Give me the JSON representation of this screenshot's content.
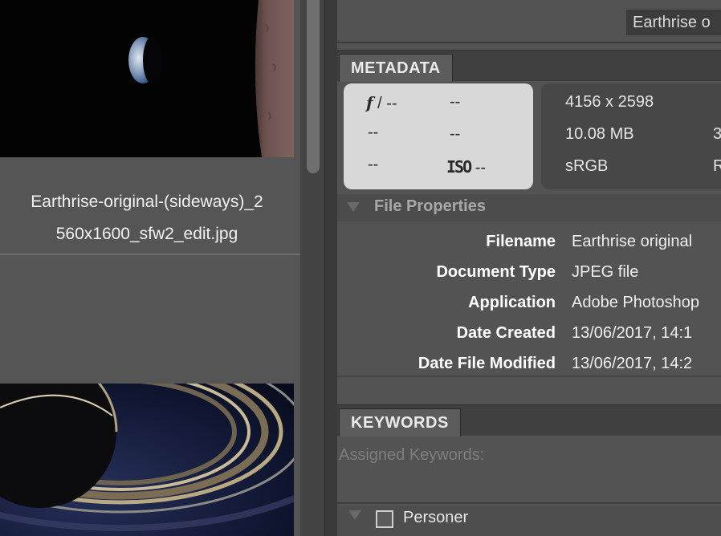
{
  "content": {
    "thumbnail_caption": "Earthrise-original-(sideways)_2 560x1600_sfw2_edit.jpg",
    "caption_line1": "Earthrise-original-(sideways)_2",
    "caption_line2": "560x1600_sfw2_edit.jpg"
  },
  "search": {
    "value": "Earthrise o"
  },
  "metadata_panel": {
    "tab_label": "METADATA",
    "camera": {
      "aperture_symbol": "f",
      "aperture_value": "/ --",
      "shutter": "--",
      "exposure_bias": "--",
      "flash": "--",
      "metering": "--",
      "iso_label": "ISO",
      "iso_value": "--"
    },
    "file_info": {
      "dimensions": "4156 x 2598",
      "file_size": "10.08 MB",
      "color_profile": "sRGB",
      "col2_row2": "3",
      "col2_row3": "R"
    }
  },
  "file_properties": {
    "title": "File Properties",
    "rows": [
      {
        "label": "Filename",
        "value": "Earthrise original"
      },
      {
        "label": "Document Type",
        "value": "JPEG file"
      },
      {
        "label": "Application",
        "value": "Adobe Photoshop"
      },
      {
        "label": "Date Created",
        "value": "13/06/2017, 14:1"
      },
      {
        "label": "Date File Modified",
        "value": "13/06/2017, 14:2"
      }
    ]
  },
  "keywords_panel": {
    "tab_label": "KEYWORDS",
    "assigned_label": "Assigned Keywords:",
    "categories": [
      {
        "label": "Personer",
        "checked": false
      }
    ]
  },
  "colors": {
    "background": "#535353",
    "panel_tab": "#5c5c5c",
    "camera_box": "#d8d8d8",
    "file_box": "#474747"
  }
}
